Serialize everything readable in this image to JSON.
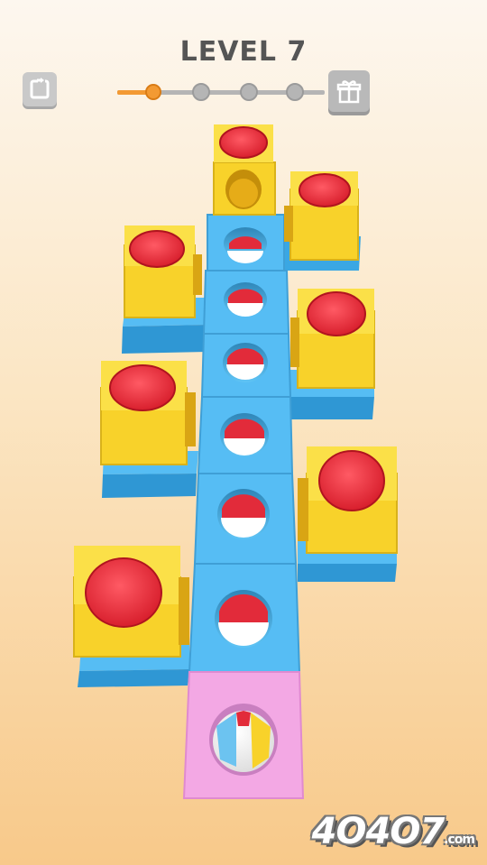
{
  "header": {
    "level_text": "LEVEL 7"
  },
  "progress": {
    "current_step": 1,
    "total_steps": 5
  },
  "buttons": {
    "restart_icon": "restart-icon",
    "gift_icon": "gift-icon"
  },
  "watermark": {
    "brand": "4O4O7",
    "suffix": ".com"
  },
  "colors": {
    "accent_orange": "#f39a33",
    "path_blue": "#56bdf4",
    "block_yellow": "#f8d22a",
    "button_red": "#e22b3a",
    "start_pink": "#f3a8e4"
  }
}
